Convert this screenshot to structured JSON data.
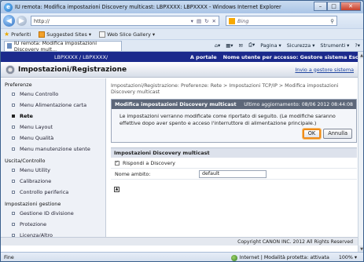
{
  "window": {
    "title": "IU remota: Modifica impostazioni Discovery multicast: LBPXXXX: LBPXXXX - Windows Internet Explorer",
    "minimize": "–",
    "maximize": "□",
    "close": "✕"
  },
  "browser": {
    "address": "http://",
    "search_placeholder": "Bing",
    "favorites_label": "Preferiti",
    "fav_items": [
      "Suggested Sites ▾",
      "Web Slice Gallery ▾"
    ],
    "tab_title": "IU remota: Modifica impostazioni Discovery mult...",
    "cmd_page": "Pagina ▾",
    "cmd_security": "Sicurezza ▾",
    "cmd_tools": "Strumenti ▾",
    "cmd_help": "?▾",
    "status_left": "Fine",
    "status_zone": "Internet | Modalità protetta: attivata",
    "status_zoom": "100% ▾"
  },
  "app": {
    "model": "LBPXXXX / LBPXXXX/",
    "portal_link": "A portale",
    "user_label": "Nome utente per accesso: Gestore sistema Esci",
    "page_heading": "Impostazioni/Registrazione",
    "system_manager_link": "Invio a gestore sistema"
  },
  "sidebar": {
    "sections": [
      {
        "title": "Preferenze",
        "items": [
          "Menu Controllo",
          "Menu Alimentazione carta",
          "Rete",
          "Menu Layout",
          "Menu Qualità",
          "Menu manutenzione utente"
        ]
      },
      {
        "title": "Uscita/Controllo",
        "items": [
          "Menu Utility",
          "Calibrazione",
          "Controllo periferica"
        ]
      },
      {
        "title": "Impostazioni gestione",
        "items": [
          "Gestione ID divisione",
          "Protezione",
          "Licenza/Altro"
        ]
      }
    ],
    "active_item": "Rete"
  },
  "main": {
    "breadcrumb": "Impostazioni/Registrazione: Preferenze: Rete > Impostazioni TCP/IP > Modifica impostazioni Discovery multicast",
    "panel_title": "Modifica impostazioni Discovery multicast",
    "last_update": "Ultimo aggiornamento: 08/06 2012 08:44:08",
    "message": "Le impostazioni verranno modificate come riportato di seguito. (Le modifiche saranno effettive dopo aver spento e acceso l'interruttore di alimentazione principale.)",
    "ok_label": "OK",
    "cancel_label": "Annulla",
    "section_title": "Impostazioni Discovery multicast",
    "respond_label": "Rispondi a Discovery",
    "respond_checked": true,
    "scope_label": "Nome ambito:",
    "scope_value": "default",
    "copyright": "Copyright CANON INC. 2012 All Rights Reserved"
  }
}
